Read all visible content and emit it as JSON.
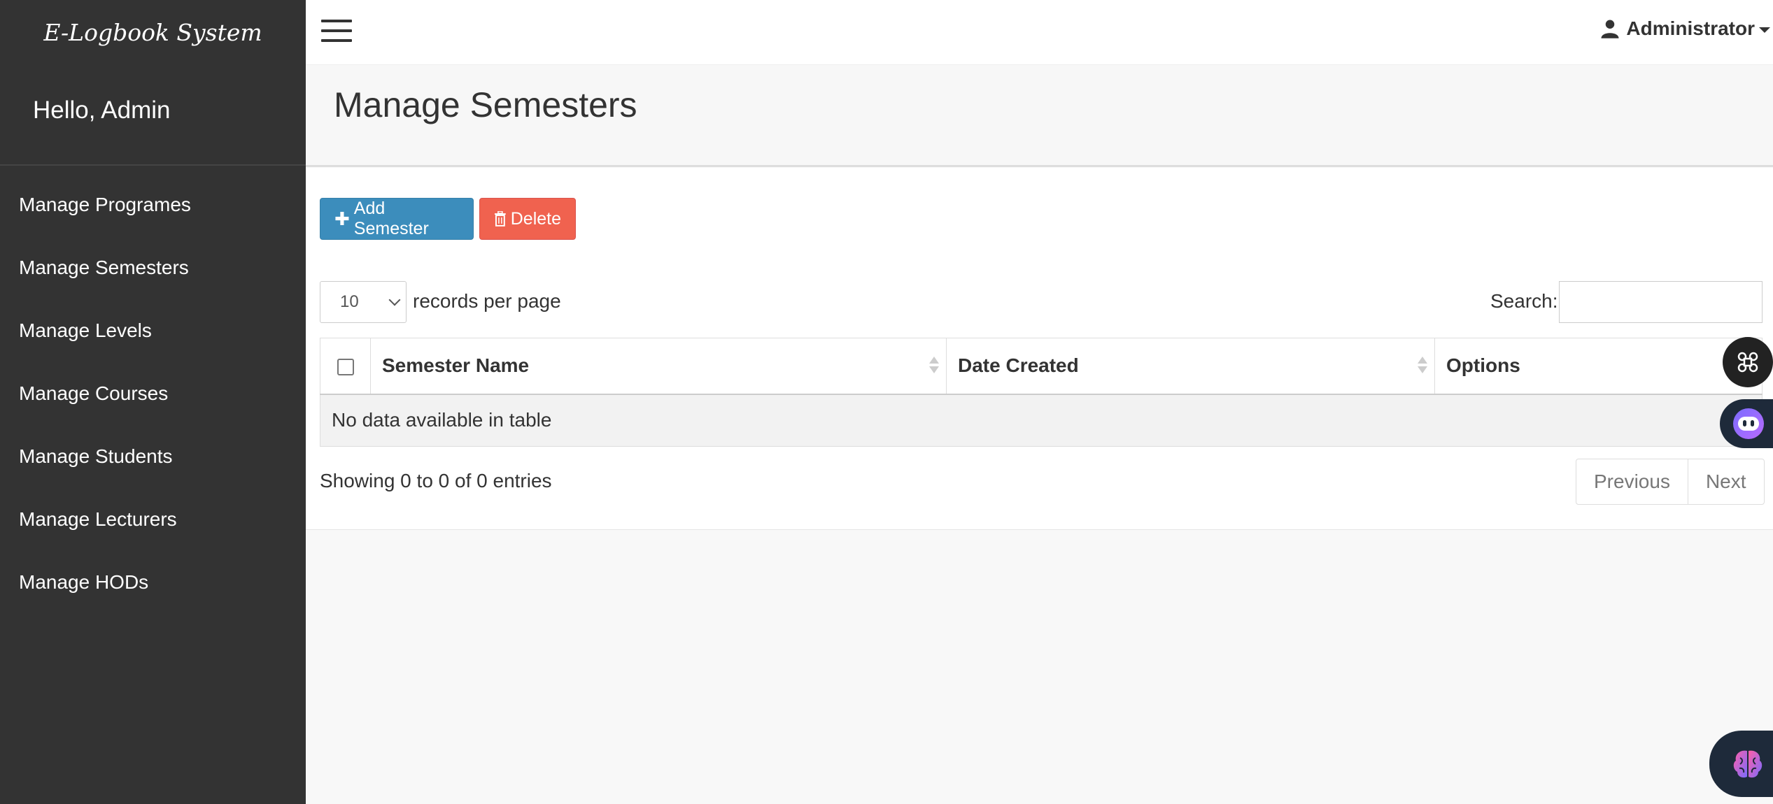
{
  "sidebar": {
    "brand": "E-Logbook System",
    "greeting": "Hello, Admin",
    "items": [
      {
        "label": "Manage Programes"
      },
      {
        "label": "Manage Semesters"
      },
      {
        "label": "Manage Levels"
      },
      {
        "label": "Manage Courses"
      },
      {
        "label": "Manage Students"
      },
      {
        "label": "Manage Lecturers"
      },
      {
        "label": "Manage HODs"
      }
    ]
  },
  "topbar": {
    "user_label": "Administrator"
  },
  "page": {
    "title": "Manage Semesters"
  },
  "toolbar": {
    "add_label": "Add Semester",
    "delete_label": "Delete"
  },
  "table_controls": {
    "page_length": "10",
    "page_length_suffix": "records per page",
    "search_label": "Search:",
    "search_value": ""
  },
  "table": {
    "columns": [
      "Semester Name",
      "Date Created",
      "Options"
    ],
    "empty_message": "No data available in table"
  },
  "footer": {
    "info": "Showing 0 to 0 of 0 entries",
    "prev_label": "Previous",
    "next_label": "Next"
  },
  "colors": {
    "sidebar_bg": "#333333",
    "add_button": "#3c8dbc",
    "delete_button": "#f0624f"
  }
}
